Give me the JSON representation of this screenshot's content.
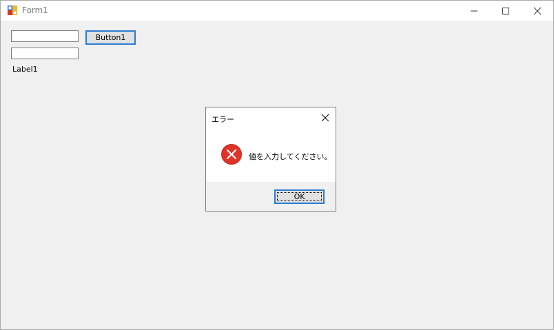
{
  "window": {
    "title": "Form1"
  },
  "form": {
    "textbox1_value": "",
    "textbox2_value": "",
    "button1_label": "Button1",
    "label1_text": "Label1"
  },
  "dialog": {
    "title": "エラー",
    "message": "値を入力してください。",
    "ok_label": "OK",
    "icon": "error-icon"
  },
  "colors": {
    "error_red": "#e0342a",
    "focus_blue": "#2d7bd2"
  }
}
